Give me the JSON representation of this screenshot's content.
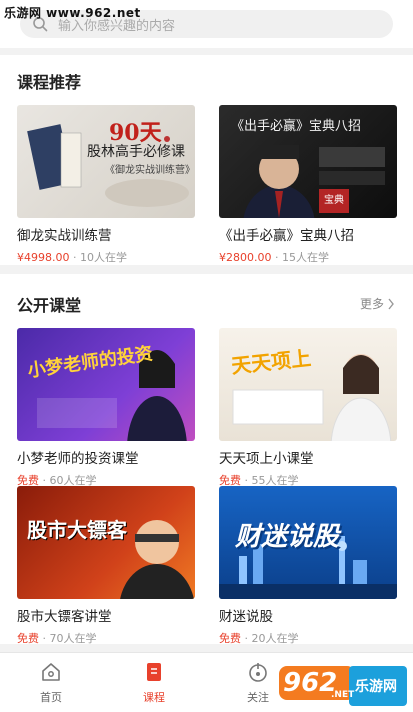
{
  "watermark_top": "乐游网 www.962.net",
  "search": {
    "placeholder": "输入你感兴趣的内容"
  },
  "recommend": {
    "title": "课程推荐",
    "courses": [
      {
        "title": "御龙实战训练营",
        "price": "¥4998.00",
        "students": "· 10人在学",
        "thumb_heading": "90天",
        "thumb_line1": "股林高手必修课",
        "thumb_line2": "《御龙实战训练营》"
      },
      {
        "title": "《出手必赢》宝典八招",
        "price": "¥2800.00",
        "students": "· 15人在学",
        "thumb_heading": "《出手必赢》宝典八招",
        "thumb_badge": "宝典"
      }
    ]
  },
  "public": {
    "title": "公开课堂",
    "more_label": "更多",
    "courses": [
      {
        "title": "小梦老师的投资课堂",
        "price": "免费",
        "students": "· 60人在学",
        "thumb_heading": "小梦老师的投资"
      },
      {
        "title": "天天项上小课堂",
        "price": "免费",
        "students": "· 55人在学",
        "thumb_heading": "天天项上"
      },
      {
        "title": "股市大镖客讲堂",
        "price": "免费",
        "students": "· 70人在学",
        "thumb_heading": "股市大镖客"
      },
      {
        "title": "财迷说股",
        "price": "免费",
        "students": "· 20人在学",
        "thumb_heading": "财迷说股"
      }
    ]
  },
  "tabs": [
    {
      "label": "首页",
      "icon": "home-icon"
    },
    {
      "label": "课程",
      "icon": "course-icon"
    },
    {
      "label": "关注",
      "icon": "follow-icon"
    }
  ],
  "watermark_bottom": {
    "number": "962",
    "suffix": ".NET",
    "name": "乐游网"
  },
  "colors": {
    "accent": "#e8412c",
    "text": "#222222",
    "muted": "#999999"
  }
}
